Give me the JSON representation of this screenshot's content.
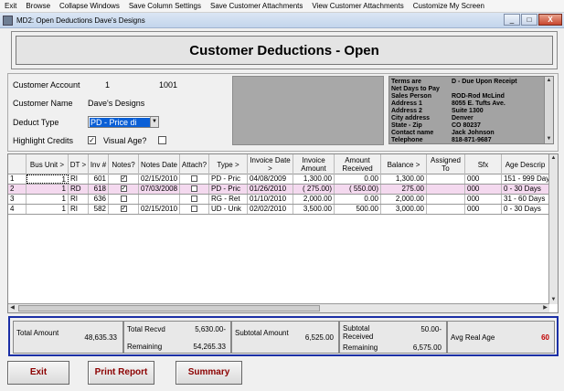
{
  "menu": [
    "Exit",
    "Browse",
    "Collapse Windows",
    "Save Column Settings",
    "Save Customer Attachments",
    "View Customer Attachments",
    "Customize My Screen"
  ],
  "window": {
    "title": "MD2: Open Deductions Dave's Designs",
    "min": "_",
    "max": "□",
    "close": "X"
  },
  "header": {
    "title": "Customer Deductions - Open"
  },
  "customer": {
    "account_label": "Customer Account",
    "account_num": "1",
    "account_code": "1001",
    "name_label": "Customer Name",
    "name": "Dave's Designs",
    "deduct_type_label": "Deduct Type",
    "deduct_type_value": "PD    - Price di",
    "highlight_label": "Highlight Credits",
    "visual_age_label": "Visual Age?"
  },
  "terms": [
    {
      "k": "Terms are",
      "v": "D - Due Upon Receipt"
    },
    {
      "k": "Net Days to Pay",
      "v": ""
    },
    {
      "k": "Sales Person",
      "v": "ROD-Rod McLind"
    },
    {
      "k": "Address 1",
      "v": "8055 E. Tufts Ave."
    },
    {
      "k": "Address 2",
      "v": "Suite 1300"
    },
    {
      "k": "City address",
      "v": "Denver"
    },
    {
      "k": "State - Zip",
      "v": "CO   80237"
    },
    {
      "k": "Contact name",
      "v": "Jack Johnson"
    },
    {
      "k": "Telephone",
      "v": "818-871-9687"
    }
  ],
  "grid": {
    "headers": [
      "Bus Unit >",
      "DT >",
      "Inv #",
      "Notes?",
      "Notes Date",
      "Attach?",
      "Type >",
      "Invoice Date >",
      "Invoice Amount",
      "Amount Received",
      "Balance >",
      "Assigned To",
      "Sfx",
      "Age Descrip"
    ],
    "rows": [
      {
        "n": "1",
        "bu": "1",
        "dt": "RI",
        "inv": "601",
        "notes": "✓",
        "nd": "02/15/2010",
        "type": "PD   - Pric",
        "idate": "04/08/2009",
        "iamt": "1,300.00",
        "recv": "0.00",
        "bal": "1,300.00",
        "asg": "",
        "sfx": "000",
        "age": "151 - 999 Days"
      },
      {
        "n": "2",
        "bu": "1",
        "dt": "RD",
        "inv": "618",
        "notes": "✓",
        "nd": "07/03/2008",
        "type": "PD   - Pric",
        "idate": "01/26/2010",
        "iamt": "( 275.00)",
        "recv": "( 550.00)",
        "bal": "275.00",
        "asg": "",
        "sfx": "000",
        "age": "0 - 30 Days"
      },
      {
        "n": "3",
        "bu": "1",
        "dt": "RI",
        "inv": "636",
        "notes": "",
        "nd": "",
        "type": "RG   - Ret",
        "idate": "01/10/2010",
        "iamt": "2,000.00",
        "recv": "0.00",
        "bal": "2,000.00",
        "asg": "",
        "sfx": "000",
        "age": "31 - 60 Days"
      },
      {
        "n": "4",
        "bu": "1",
        "dt": "RI",
        "inv": "582",
        "notes": "✓",
        "nd": "02/15/2010",
        "type": "UD   - Unk",
        "idate": "02/02/2010",
        "iamt": "3,500.00",
        "recv": "500.00",
        "bal": "3,000.00",
        "asg": "",
        "sfx": "000",
        "age": "0 - 30 Days"
      }
    ]
  },
  "totals": {
    "total_amount_label": "Total Amount",
    "total_amount": "48,635.33",
    "total_recvd_label": "Total Recvd",
    "total_recvd": "5,630.00-",
    "remaining_label": "Remaining",
    "remaining": "54,265.33",
    "subtotal_amount_label": "Subtotal Amount",
    "subtotal_amount": "6,525.00",
    "subtotal_received_label": "Subtotal Received",
    "subtotal_received": "50.00-",
    "sub_remaining_label": "Remaining",
    "sub_remaining": "6,575.00",
    "avg_age_label": "Avg Real Age",
    "avg_age": "60"
  },
  "buttons": {
    "exit": "Exit",
    "print": "Print Report",
    "summary": "Summary"
  },
  "colors": {
    "accent_border": "#1b2fa6",
    "button_text": "#8b0000",
    "selected_row": "#f4d9ef",
    "avg_age": "#c00000"
  }
}
